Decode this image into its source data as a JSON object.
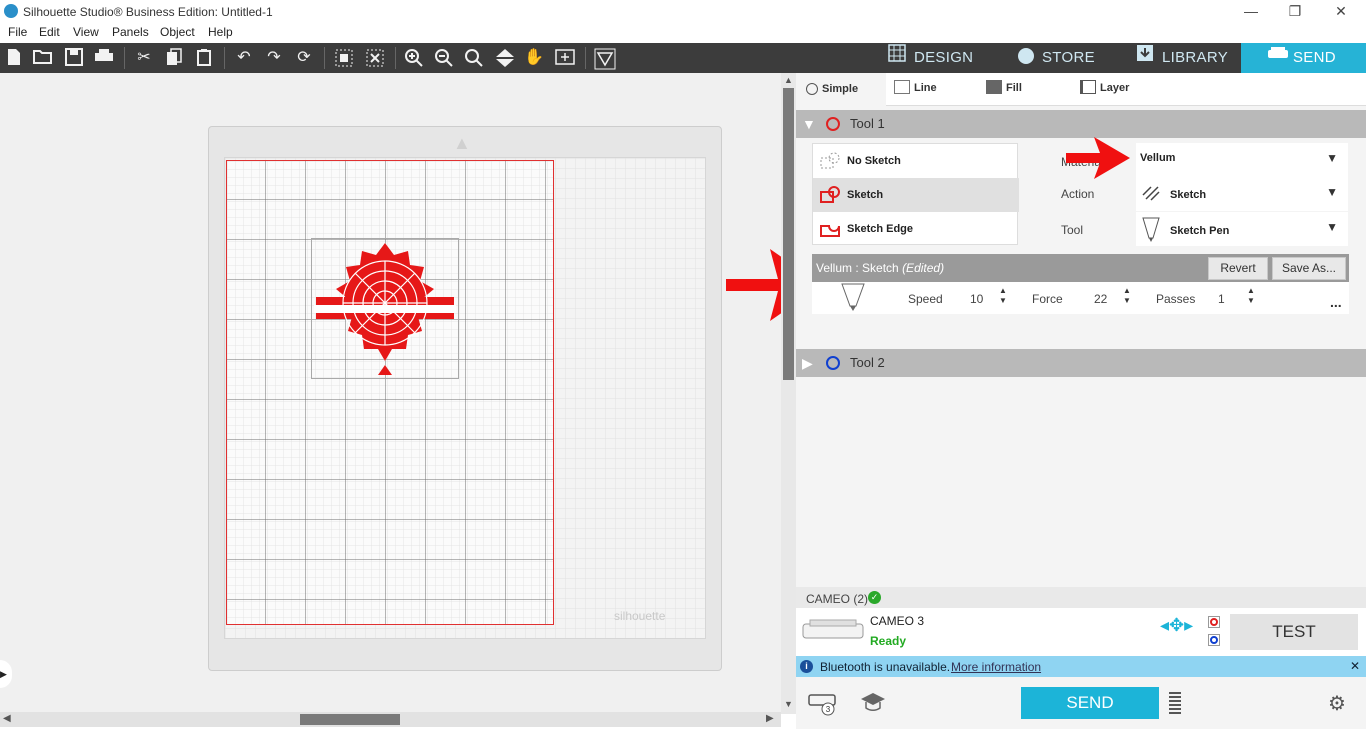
{
  "window": {
    "title": "Silhouette Studio® Business Edition: Untitled-1",
    "minimize": "—",
    "restore": "❐",
    "close": "✕"
  },
  "menu": [
    "File",
    "Edit",
    "View",
    "Panels",
    "Object",
    "Help"
  ],
  "toolbar_icons": [
    "new-document-icon",
    "open-folder-icon",
    "save-icon",
    "print-icon",
    "cut-icon",
    "copy-icon",
    "paste-icon",
    "undo-icon",
    "redo-icon",
    "redraw-icon",
    "group-icon",
    "ungroup-icon",
    "zoom-in-icon",
    "zoom-out-icon",
    "zoom-select-icon",
    "move-down-icon",
    "pan-hand-icon",
    "fit-to-page-icon",
    "trace-icon"
  ],
  "tabs": [
    {
      "label": "DESIGN",
      "icon": "grid-icon"
    },
    {
      "label": "STORE",
      "icon": "silhouette-s-icon"
    },
    {
      "label": "LIBRARY",
      "icon": "library-download-icon"
    },
    {
      "label": "SEND",
      "icon": "cutter-icon"
    }
  ],
  "mode_tabs": [
    "Simple",
    "Line",
    "Fill",
    "Layer"
  ],
  "canvas": {
    "watermark": "silhouette"
  },
  "tool1": {
    "label": "Tool 1",
    "ring_color": "#e02020",
    "sketch_options": [
      "No Sketch",
      "Sketch",
      "Sketch Edge"
    ],
    "selected_option": "Sketch",
    "material_label": "Material",
    "material_value": "Vellum",
    "action_label": "Action",
    "action_value": "Sketch",
    "tool_label": "Tool",
    "tool_value": "Sketch Pen",
    "edit_bar_text": "Vellum : Sketch",
    "edit_bar_edited": "(Edited)",
    "revert": "Revert",
    "save_as": "Save As...",
    "speed_label": "Speed",
    "speed_value": "10",
    "force_label": "Force",
    "force_value": "22",
    "passes_label": "Passes",
    "passes_value": "1",
    "more": "..."
  },
  "tool2": {
    "label": "Tool 2",
    "ring_color": "#1040d0"
  },
  "device": {
    "list_label": "CAMEO (2)",
    "name": "CAMEO 3",
    "status": "Ready",
    "status_color": "#22aa22",
    "test": "TEST"
  },
  "bluetooth": {
    "message": "Bluetooth is unavailable.",
    "link": "More information",
    "close": "✕"
  },
  "send_button": "SEND",
  "accent": "#26b3d6"
}
